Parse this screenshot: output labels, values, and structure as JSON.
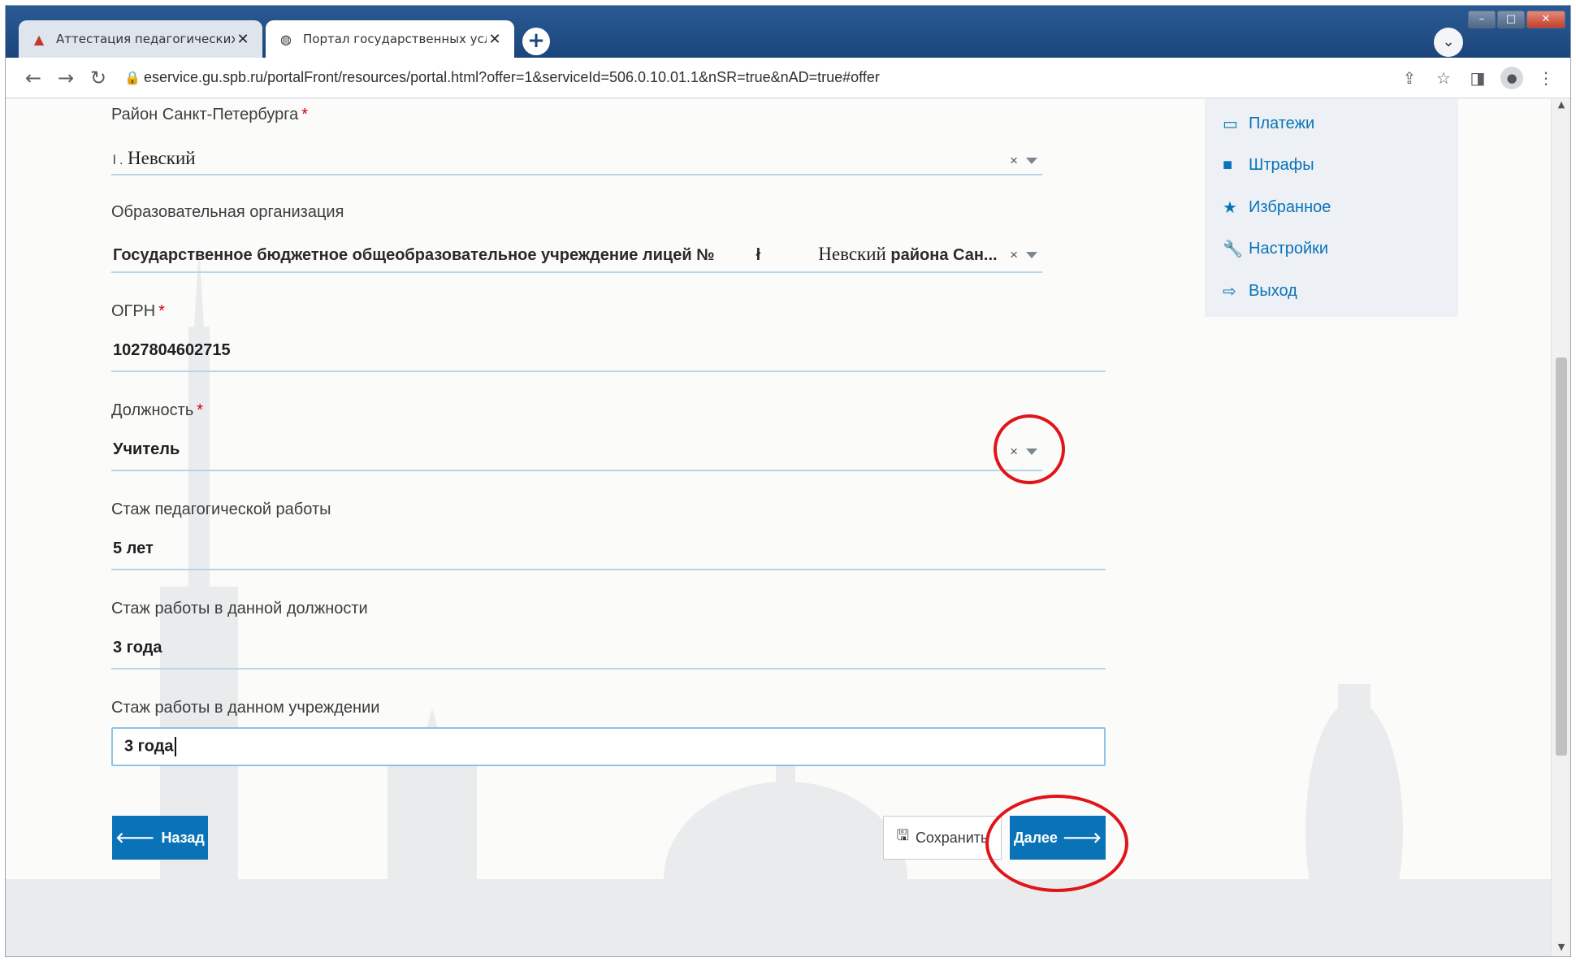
{
  "browser": {
    "tabs": [
      {
        "title": "Аттестация педагогических раб",
        "favicon": "triangle-logo-icon",
        "active": false
      },
      {
        "title": "Портал государственных услуг",
        "favicon": "globe-icon",
        "active": true
      }
    ],
    "url": "eservice.gu.spb.ru/portalFront/resources/portal.html?offer=1&serviceId=506.0.10.01.1&nSR=true&nAD=true#offer"
  },
  "form": {
    "district": {
      "label": "Район Санкт-Петербурга",
      "required_mark": "*",
      "prefix": "l .",
      "value": "Невский",
      "clear": "×"
    },
    "organization": {
      "label": "Образовательная организация",
      "value": "Государственное бюджетное общеобразовательное учреждение лицей №",
      "value_mid": "Невский",
      "value_end": "района Сан...",
      "clear": "×"
    },
    "ogrn": {
      "label": "ОГРН",
      "required_mark": "*",
      "value": "1027804602715"
    },
    "position": {
      "label": "Должность",
      "required_mark": "*",
      "value": "Учитель",
      "clear": "×"
    },
    "exp_pedagogical": {
      "label": "Стаж педагогической работы",
      "value": "5 лет"
    },
    "exp_position": {
      "label": "Стаж работы в данной должности",
      "value": "3 года"
    },
    "exp_institution": {
      "label": "Стаж работы в данном учреждении",
      "value": "3 года"
    }
  },
  "buttons": {
    "back": "Назад",
    "save": "Сохранить",
    "next": "Далее"
  },
  "side_menu": [
    {
      "label": "Платежи",
      "icon": "card-icon"
    },
    {
      "label": "Штрафы",
      "icon": "note-icon"
    },
    {
      "label": "Избранное",
      "icon": "star-icon"
    },
    {
      "label": "Настройки",
      "icon": "wrench-icon"
    },
    {
      "label": "Выход",
      "icon": "logout-icon"
    }
  ],
  "colors": {
    "accent": "#0a73b8",
    "annotation": "#e0151b",
    "field_line": "#b8d4e8"
  }
}
